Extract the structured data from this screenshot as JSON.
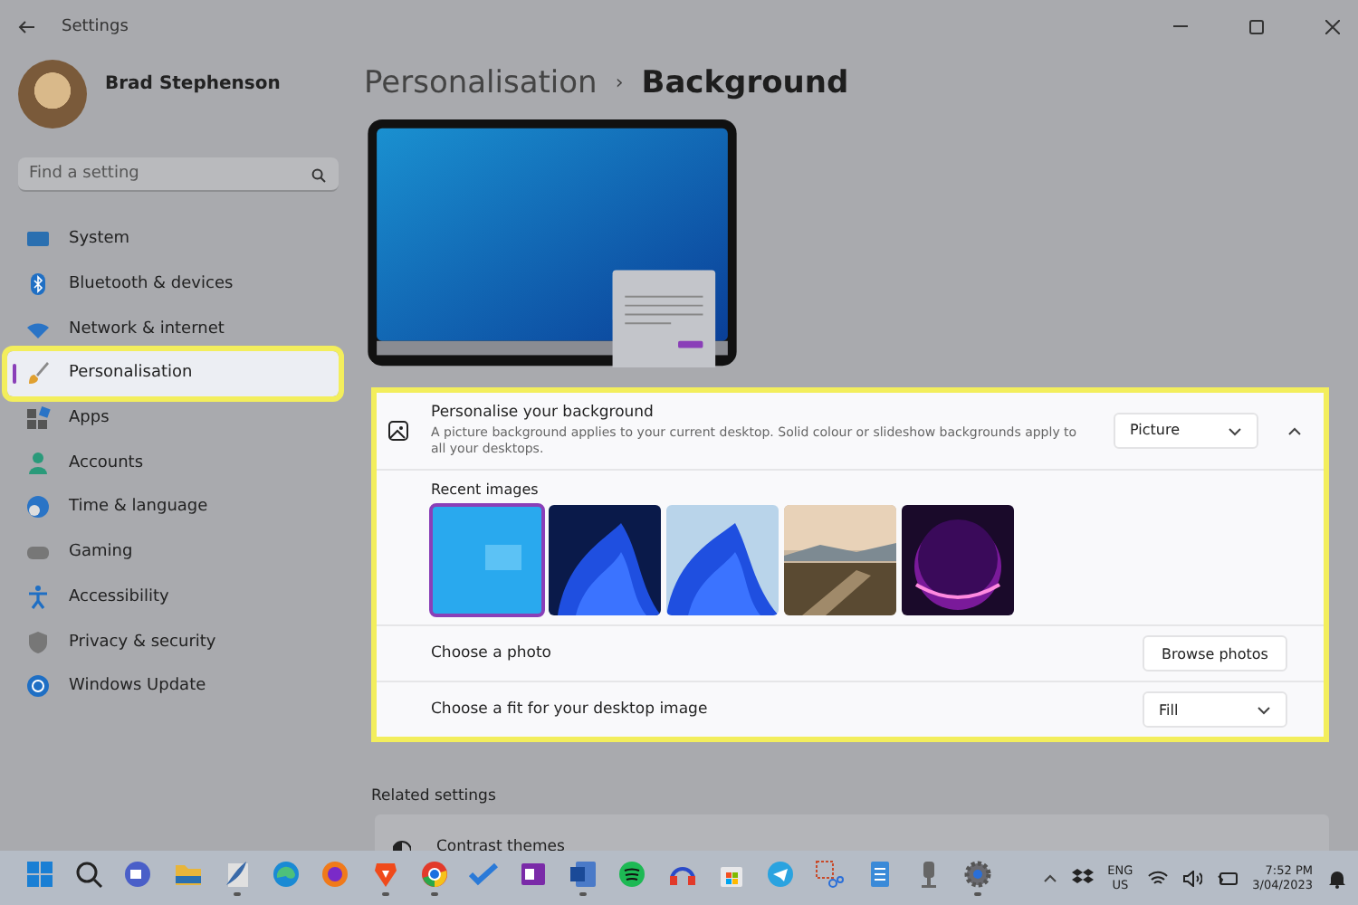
{
  "window": {
    "title": "Settings"
  },
  "user": {
    "name": "Brad Stephenson"
  },
  "search": {
    "placeholder": "Find a setting"
  },
  "nav": [
    {
      "label": "System",
      "kind": "system",
      "selected": false,
      "highlighted": false
    },
    {
      "label": "Bluetooth & devices",
      "kind": "bluetooth",
      "selected": false,
      "highlighted": false
    },
    {
      "label": "Network & internet",
      "kind": "network",
      "selected": false,
      "highlighted": false
    },
    {
      "label": "Personalisation",
      "kind": "brush",
      "selected": true,
      "highlighted": true
    },
    {
      "label": "Apps",
      "kind": "apps",
      "selected": false,
      "highlighted": false
    },
    {
      "label": "Accounts",
      "kind": "accounts",
      "selected": false,
      "highlighted": false
    },
    {
      "label": "Time & language",
      "kind": "time",
      "selected": false,
      "highlighted": false
    },
    {
      "label": "Gaming",
      "kind": "gaming",
      "selected": false,
      "highlighted": false
    },
    {
      "label": "Accessibility",
      "kind": "accessibility",
      "selected": false,
      "highlighted": false
    },
    {
      "label": "Privacy & security",
      "kind": "privacy",
      "selected": false,
      "highlighted": false
    },
    {
      "label": "Windows Update",
      "kind": "update",
      "selected": false,
      "highlighted": false
    }
  ],
  "breadcrumb": {
    "parent": "Personalisation",
    "separator": "›",
    "current": "Background"
  },
  "background_card": {
    "highlighted": true,
    "title": "Personalise your background",
    "description": "A picture background applies to your current desktop. Solid colour or slideshow backgrounds apply to all your desktops.",
    "mode": "Picture",
    "expanded": true,
    "recent_label": "Recent images",
    "images": [
      {
        "kind": "picture",
        "selected": true
      },
      {
        "kind": "picture",
        "selected": false
      },
      {
        "kind": "picture",
        "selected": false
      },
      {
        "kind": "picture",
        "selected": false
      },
      {
        "kind": "picture",
        "selected": false
      }
    ],
    "rows": [
      {
        "kind": "button",
        "label": "Choose a photo",
        "control": "Browse photos"
      },
      {
        "kind": "dropdown",
        "label": "Choose a fit for your desktop image",
        "control": "Fill"
      }
    ]
  },
  "related": {
    "heading": "Related settings",
    "items": [
      {
        "label": "Contrast themes"
      }
    ]
  },
  "taskbar": {
    "apps": [
      {
        "kind": "start",
        "running": false
      },
      {
        "kind": "search",
        "running": false
      },
      {
        "kind": "meet",
        "running": false
      },
      {
        "kind": "folder",
        "running": false
      },
      {
        "kind": "feather",
        "running": true
      },
      {
        "kind": "edge",
        "running": false
      },
      {
        "kind": "firefox",
        "running": false
      },
      {
        "kind": "brave",
        "running": true
      },
      {
        "kind": "chrome",
        "running": true
      },
      {
        "kind": "todo",
        "running": false
      },
      {
        "kind": "onenote",
        "running": false
      },
      {
        "kind": "word",
        "running": true
      },
      {
        "kind": "spotify",
        "running": false
      },
      {
        "kind": "headphones",
        "running": false
      },
      {
        "kind": "store",
        "running": false
      },
      {
        "kind": "telegram",
        "running": false
      },
      {
        "kind": "snip",
        "running": false
      },
      {
        "kind": "notepad",
        "running": false
      },
      {
        "kind": "mic",
        "running": false
      },
      {
        "kind": "settings",
        "running": true
      }
    ],
    "language": "ENG",
    "region": "US",
    "time": "7:52 PM",
    "date": "3/04/2023"
  }
}
